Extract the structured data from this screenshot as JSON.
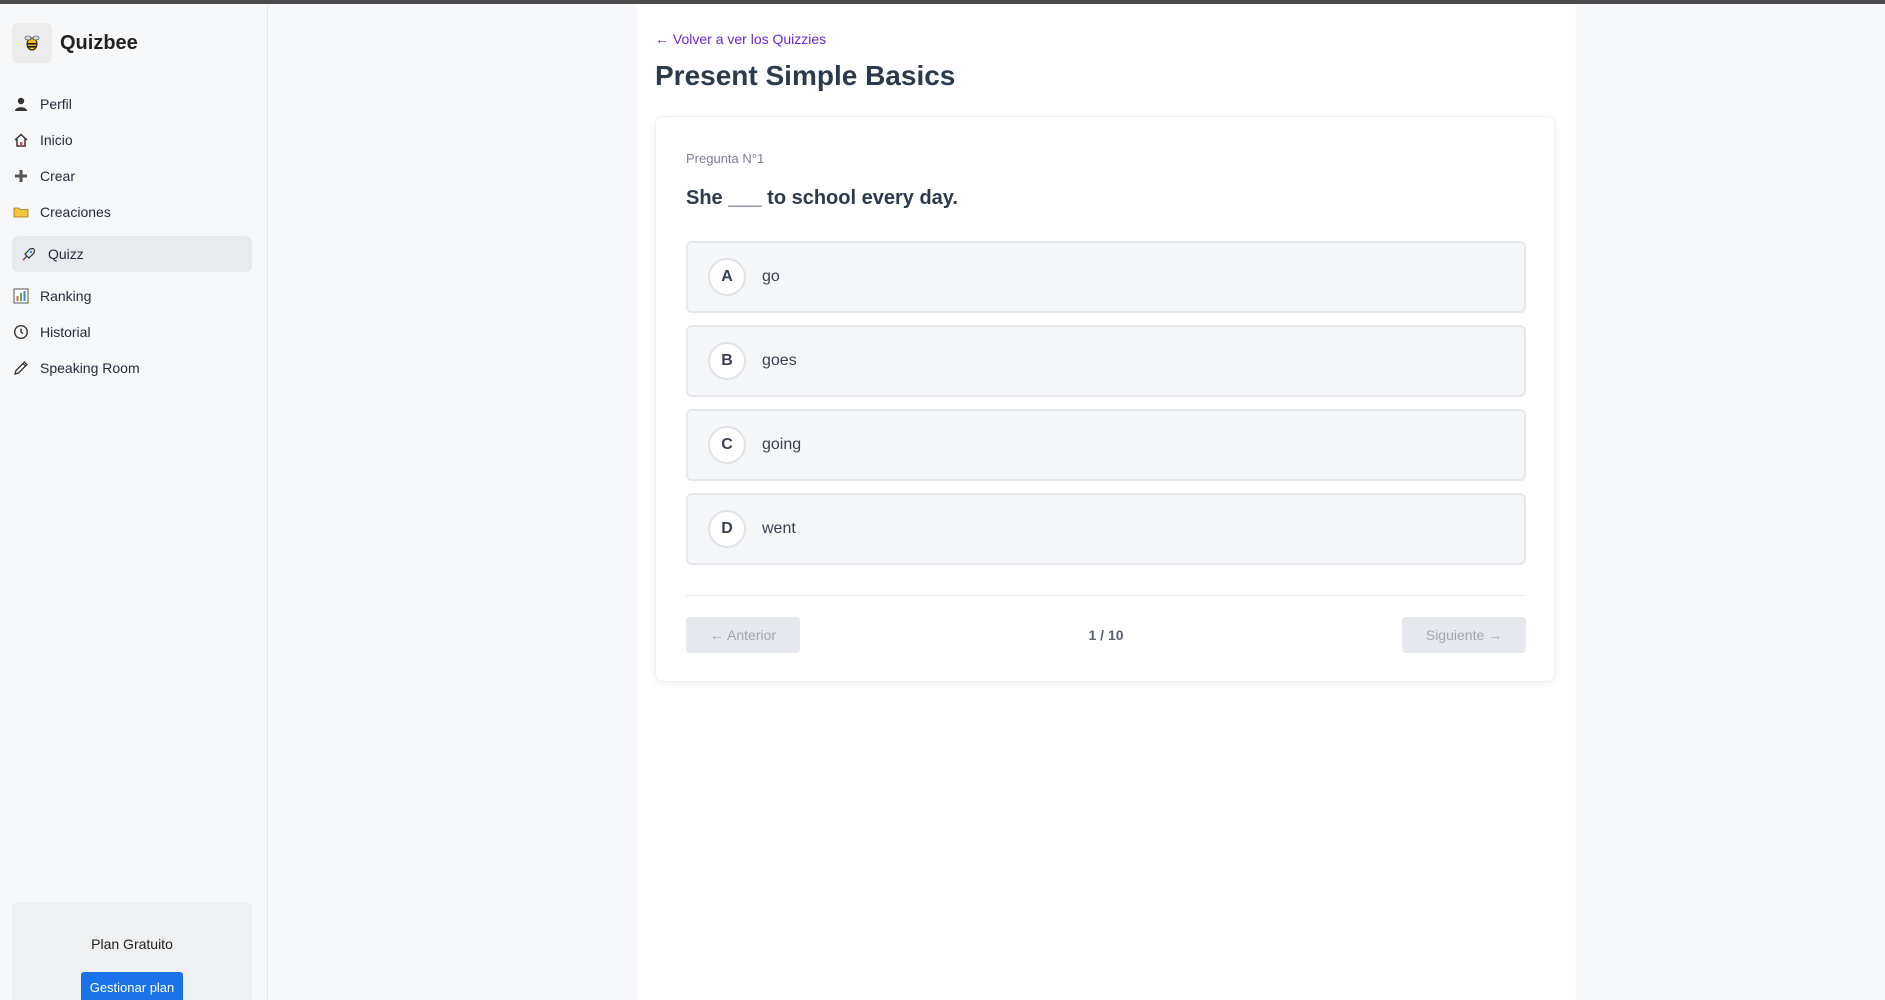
{
  "app": {
    "name": "Quizbee"
  },
  "sidebar": {
    "items": [
      {
        "label": "Perfil",
        "icon": "user-icon"
      },
      {
        "label": "Inicio",
        "icon": "home-icon"
      },
      {
        "label": "Crear",
        "icon": "plus-icon"
      },
      {
        "label": "Creaciones",
        "icon": "folder-icon"
      },
      {
        "label": "Quizz",
        "icon": "rocket-icon",
        "active": true
      },
      {
        "label": "Ranking",
        "icon": "bar-chart-icon"
      },
      {
        "label": "Historial",
        "icon": "clock-icon"
      },
      {
        "label": "Speaking Room",
        "icon": "pen-icon"
      }
    ],
    "plan": {
      "label": "Plan Gratuito",
      "button": "Gestionar plan"
    }
  },
  "main": {
    "back_link": "← Volver a ver los Quizzies",
    "title": "Present Simple Basics",
    "question": {
      "number_label": "Pregunta N°1",
      "text": "She ___ to school every day.",
      "options": [
        {
          "letter": "A",
          "text": "go"
        },
        {
          "letter": "B",
          "text": "goes"
        },
        {
          "letter": "C",
          "text": "going"
        },
        {
          "letter": "D",
          "text": "went"
        }
      ]
    },
    "nav": {
      "prev": "← Anterior",
      "pager": "1 / 10",
      "next": "Siguiente →"
    }
  },
  "colors": {
    "accent": "#6d28d9",
    "primary_button": "#1a73e8"
  }
}
